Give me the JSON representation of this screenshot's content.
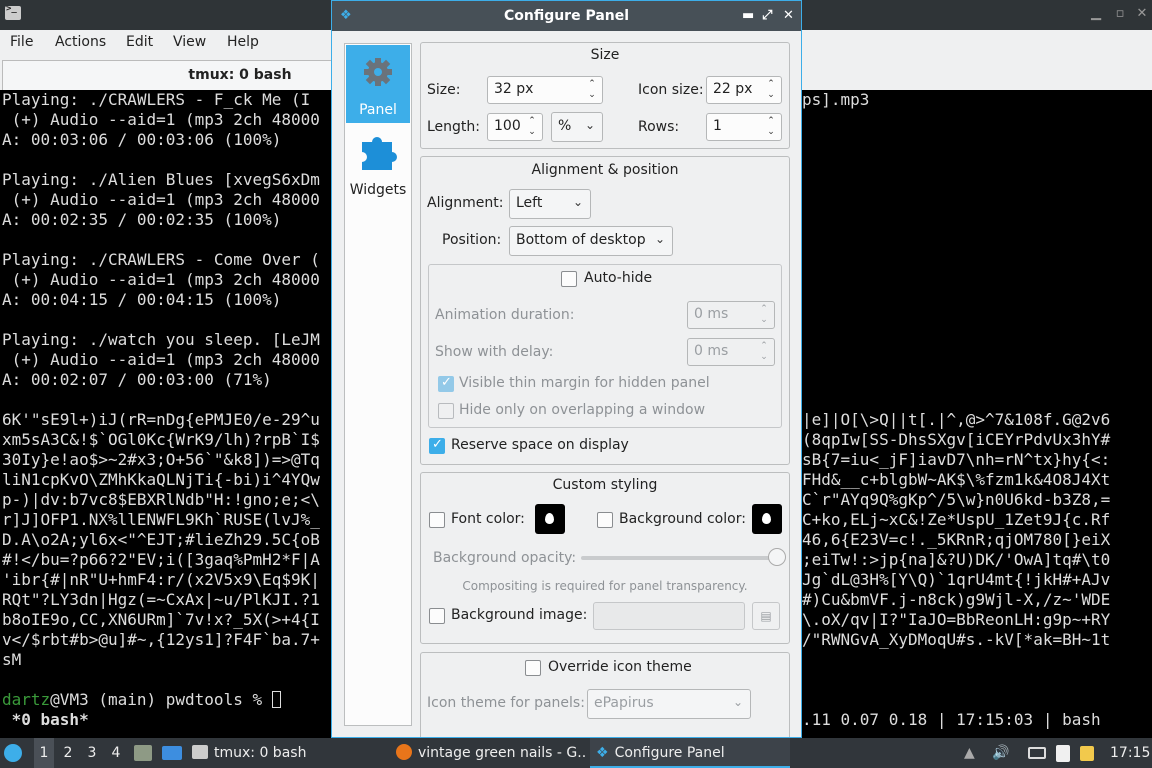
{
  "terminal": {
    "menu": [
      "File",
      "Actions",
      "Edit",
      "View",
      "Help"
    ],
    "tab_title": "tmux: 0 bash",
    "left_lines": [
      "Playing: ./CRAWLERS - F_ck Me (I",
      " (+) Audio --aid=1 (mp3 2ch 48000",
      "A: 00:03:06 / 00:03:06 (100%)",
      "",
      "Playing: ./Alien Blues [xvegS6xDm",
      " (+) Audio --aid=1 (mp3 2ch 48000",
      "A: 00:02:35 / 00:02:35 (100%)",
      "",
      "Playing: ./CRAWLERS - Come Over (",
      " (+) Audio --aid=1 (mp3 2ch 48000",
      "A: 00:04:15 / 00:04:15 (100%)",
      "",
      "Playing: ./watch you sleep. [LeJM",
      " (+) Audio --aid=1 (mp3 2ch 48000",
      "A: 00:02:07 / 00:03:00 (71%)",
      "",
      "6K'\"sE9l+)iJ(rR=nDg{ePMJE0/e-29^u",
      "xm5sA3C&!$`OGl0Kc{WrK9/lh)?rpB`I$",
      "30Iy}e!ao$>~2#x3;O+56`\"&k8])=>@Tq",
      "liN1cpKvO\\ZMhKkaQLNjTi{-bi)i^4YQw",
      "p-)|dv:b7vc8$EBXRlNdb\"H:!gno;e;<\\",
      "r]J]OFP1.NX%llENWFL9Kh`RUSE(lvJ%_",
      "D.A\\o2A;yl6x<\"^EJT;#lieZh29.5C{oB",
      "#!</bu=?p66?2\"EV;i([3gaq%PmH2*F|A",
      "'ibr{#|nR\"U+hmF4:r/(x2V5x9\\Eq$9K|",
      "RQt\"?LY3dn|Hgz(=~CxAx|~u/PlKJI.?1",
      "b8oIE9o,CC,XN6URm]`7v!x?_5X(>+4{I",
      "v</$rbt#b>@u]#~,{12ys1]?F4F`ba.7+",
      "sM"
    ],
    "right_lines": [
      "ps].mp3",
      "",
      "",
      "",
      "",
      "",
      "",
      "",
      "",
      "",
      "",
      "",
      "",
      "",
      "",
      "",
      "|e]|O[\\>Q||t[.|^,@>^7&108f.G@2v6",
      "(8qpIw[SS-DhsSXgv[iCEYrPdvUx3hY#",
      "sB{7=iu<_jF]iavD7\\nh=rN^tx}hy{<:",
      "FHd&__c+blgbW~AK$\\%fzm1k&4O8J4Xt",
      "C`r\"AYq9Q%gKp^/5\\w}n0U6kd-b3Z8,=",
      "C+ko,ELj~xC&!Ze*UspU_1Zet9J{c.Rf",
      "46,6{E23V=c!._5KRnR;qjOM780[}eiX",
      ";eiTw!:>jp{na]&?U)DK/'OwA]tq#\\t0",
      "Jg`dL@3H%[Y\\Q)`1qrU4mt{!jkH#+AJv",
      "#)Cu&bmVF.j-n8ck)g9Wjl-X,/z~'WDE",
      "\\.oX/qv|I?\"IaJO=BbReonLH:g9p~+RY",
      "/\"RWNGvA_XyDMoqU#s.-kV[*ak=BH~1t"
    ],
    "prompt_user": "dartz",
    "prompt_rest": "@VM3 (main) pwdtools % ",
    "status_left": " *0 bash*",
    "status_right": ".11 0.07 0.18 | 17:15:03 | bash"
  },
  "dialog": {
    "title": "Configure Panel",
    "categories": [
      {
        "label": "Panel",
        "icon": "gear-icon",
        "selected": true
      },
      {
        "label": "Widgets",
        "icon": "puzzle-icon",
        "selected": false
      }
    ],
    "size_group": {
      "title": "Size",
      "size_label": "Size:",
      "size_value": "32 px",
      "icon_size_label": "Icon size:",
      "icon_size_value": "22 px",
      "length_label": "Length:",
      "length_value": "100",
      "length_unit": "%",
      "rows_label": "Rows:",
      "rows_value": "1"
    },
    "alignment_group": {
      "title": "Alignment & position",
      "alignment_label": "Alignment:",
      "alignment_value": "Left",
      "position_label": "Position:",
      "position_value": "Bottom of desktop",
      "autohide_label": "Auto-hide",
      "autohide_checked": false,
      "animation_label": "Animation duration:",
      "animation_value": "0 ms",
      "delay_label": "Show with delay:",
      "delay_value": "0 ms",
      "thin_margin_label": "Visible thin margin for hidden panel",
      "thin_margin_checked": true,
      "overlap_label": "Hide only on overlapping a window",
      "overlap_checked": false,
      "reserve_label": "Reserve space on display",
      "reserve_checked": true
    },
    "styling_group": {
      "title": "Custom styling",
      "font_color_label": "Font color:",
      "bg_color_label": "Background color:",
      "opacity_label": "Background opacity:",
      "opacity_value": 1.0,
      "compositing_note": "Compositing is required for panel transparency.",
      "bg_image_label": "Background image:"
    },
    "icon_theme_group": {
      "override_label": "Override icon theme",
      "override_checked": false,
      "theme_label": "Icon theme for panels:",
      "theme_value": "ePapirus"
    }
  },
  "taskbar": {
    "workspaces": [
      "1",
      "2",
      "3",
      "4"
    ],
    "tasks": [
      "tmux: 0 bash",
      "vintage green nails - G...",
      "Configure Panel"
    ],
    "clock": "17:15"
  },
  "colors": {
    "accent": "#3daee9",
    "terminal_bg": "#000000",
    "prompt_user": "#3a9a3a",
    "dialog_bg": "#eff0f1",
    "taskbar_bg": "#31363b"
  }
}
